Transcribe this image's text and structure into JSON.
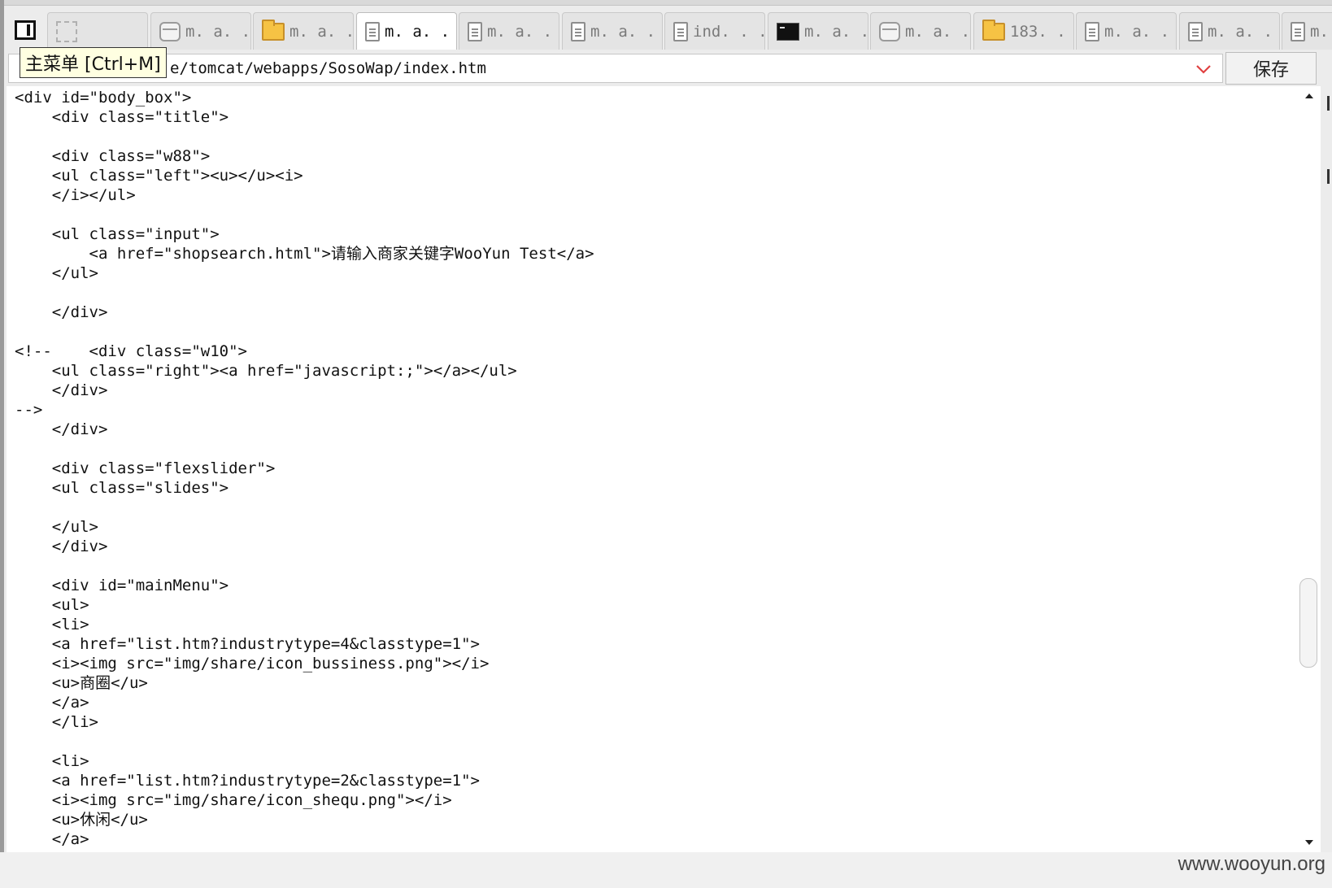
{
  "menu_button": {
    "tooltip": "主菜单 [Ctrl+M]",
    "icon": "panel-icon"
  },
  "tabs": [
    {
      "label": "",
      "icon": "blank-icon",
      "active": false
    },
    {
      "label": "m. a. . .",
      "icon": "drive-icon",
      "active": false
    },
    {
      "label": "m. a. . .",
      "icon": "folder-icon",
      "active": false
    },
    {
      "label": "m. a. . .",
      "icon": "document-icon",
      "active": true
    },
    {
      "label": "m. a. . .",
      "icon": "document-icon",
      "active": false
    },
    {
      "label": "m. a. . .",
      "icon": "document-icon",
      "active": false
    },
    {
      "label": "ind. . .",
      "icon": "document-icon",
      "active": false
    },
    {
      "label": "m. a. . .",
      "icon": "terminal-icon",
      "active": false
    },
    {
      "label": "m. a. . .",
      "icon": "drive-icon",
      "active": false
    },
    {
      "label": "183. . .",
      "icon": "folder-icon",
      "active": false
    },
    {
      "label": "m. a. . .",
      "icon": "document-icon",
      "active": false
    },
    {
      "label": "m. a. . .",
      "icon": "document-icon",
      "active": false
    },
    {
      "label": "m.",
      "icon": "document-icon",
      "active": false
    }
  ],
  "address": {
    "path_visible": "e/tomcat/webapps/SosoWap/index.htm",
    "save_label": "保存"
  },
  "editor": {
    "lines": [
      "<div id=\"body_box\">",
      "    <div class=\"title\">",
      "",
      "    <div class=\"w88\">",
      "    <ul class=\"left\"><u></u><i>",
      "    </i></ul>",
      "",
      "    <ul class=\"input\">",
      "        <a href=\"shopsearch.html\">请输入商家关键字WooYun Test</a>",
      "    </ul>",
      "",
      "    </div>",
      "",
      "<!--    <div class=\"w10\">",
      "    <ul class=\"right\"><a href=\"javascript:;\"></a></ul>",
      "    </div>",
      "-->",
      "    </div>",
      "",
      "    <div class=\"flexslider\">",
      "    <ul class=\"slides\">",
      "",
      "    </ul>",
      "    </div>",
      "",
      "    <div id=\"mainMenu\">",
      "    <ul>",
      "    <li>",
      "    <a href=\"list.htm?industrytype=4&classtype=1\">",
      "    <i><img src=\"img/share/icon_bussiness.png\"></i>",
      "    <u>商圈</u>",
      "    </a>",
      "    </li>",
      "",
      "    <li>",
      "    <a href=\"list.htm?industrytype=2&classtype=1\">",
      "    <i><img src=\"img/share/icon_shequ.png\"></i>",
      "    <u>休闲</u>",
      "    </a>"
    ]
  },
  "watermark": "www.wooyun.org",
  "colors": {
    "background": "#ececec",
    "editor_bg": "#ffffff",
    "text": "#111111",
    "dropdown_arrow": "#e04040",
    "tooltip_bg": "#ffffe1"
  }
}
